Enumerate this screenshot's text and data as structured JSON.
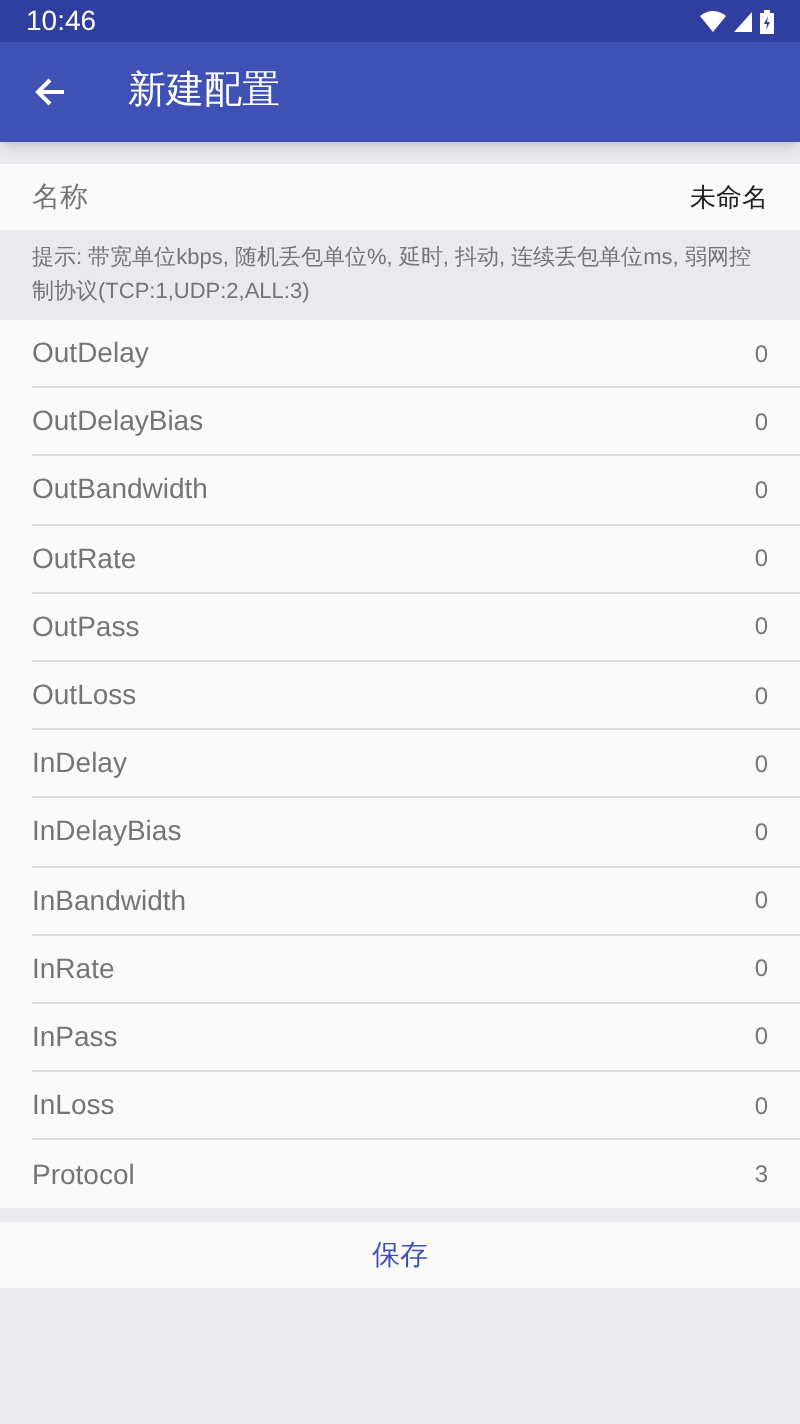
{
  "status_bar": {
    "time": "10:46"
  },
  "app_bar": {
    "title": "新建配置"
  },
  "name_row": {
    "label": "名称",
    "value": "未命名"
  },
  "hint": "提示: 带宽单位kbps, 随机丢包单位%, 延时, 抖动, 连续丢包单位ms, 弱网控制协议(TCP:1,UDP:2,ALL:3)",
  "params": [
    {
      "label": "OutDelay",
      "value": "0"
    },
    {
      "label": "OutDelayBias",
      "value": "0"
    },
    {
      "label": "OutBandwidth",
      "value": "0"
    },
    {
      "label": "OutRate",
      "value": "0"
    },
    {
      "label": "OutPass",
      "value": "0"
    },
    {
      "label": "OutLoss",
      "value": "0"
    },
    {
      "label": "InDelay",
      "value": "0"
    },
    {
      "label": "InDelayBias",
      "value": "0"
    },
    {
      "label": "InBandwidth",
      "value": "0"
    },
    {
      "label": "InRate",
      "value": "0"
    },
    {
      "label": "InPass",
      "value": "0"
    },
    {
      "label": "InLoss",
      "value": "0"
    },
    {
      "label": "Protocol",
      "value": "3"
    }
  ],
  "save_button": "保存"
}
